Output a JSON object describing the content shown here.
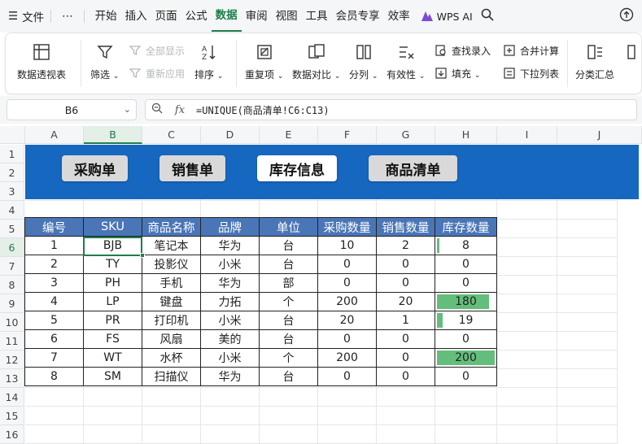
{
  "menubar": {
    "file": "文件",
    "more": "⋯",
    "tabs": [
      "开始",
      "插入",
      "页面",
      "公式",
      "数据",
      "审阅",
      "视图",
      "工具",
      "会员专享",
      "效率"
    ],
    "active_tab": "数据",
    "ai_label": "WPS AI"
  },
  "ribbon": {
    "pivot": "数据透视表",
    "filter": "筛选",
    "show_all": "全部显示",
    "reapply": "重新应用",
    "sort": "排序",
    "duplicates": "重复项",
    "compare": "数据对比",
    "split": "分列",
    "validity": "有效性",
    "find_entry": "查找录入",
    "fill": "填充",
    "consolidate": "合并计算",
    "dropdown_list": "下拉列表",
    "subtotal": "分类汇总"
  },
  "formula_bar": {
    "name_box": "B6",
    "fx": "fx",
    "formula": "=UNIQUE(商品清单!C6:C13)"
  },
  "columns": [
    "A",
    "B",
    "C",
    "D",
    "E",
    "F",
    "G",
    "H",
    "I",
    "J"
  ],
  "rows": [
    "1",
    "2",
    "3",
    "4",
    "5",
    "6",
    "7",
    "8",
    "9",
    "10",
    "11",
    "12",
    "13",
    "14",
    "15",
    "16"
  ],
  "selected_column": "B",
  "selected_row": "6",
  "nav_buttons": [
    {
      "label": "采购单",
      "active": false
    },
    {
      "label": "销售单",
      "active": false
    },
    {
      "label": "库存信息",
      "active": true
    },
    {
      "label": "商品清单",
      "active": false
    }
  ],
  "table": {
    "headers": [
      "编号",
      "SKU",
      "商品名称",
      "品牌",
      "单位",
      "采购数量",
      "销售数量",
      "库存数量"
    ],
    "rows": [
      [
        "1",
        "BJB",
        "笔记本",
        "华为",
        "台",
        "10",
        "2",
        "8"
      ],
      [
        "2",
        "TY",
        "投影仪",
        "小米",
        "台",
        "0",
        "0",
        "0"
      ],
      [
        "3",
        "PH",
        "手机",
        "华为",
        "部",
        "0",
        "0",
        "0"
      ],
      [
        "4",
        "LP",
        "键盘",
        "力拓",
        "个",
        "200",
        "20",
        "180"
      ],
      [
        "5",
        "PR",
        "打印机",
        "小米",
        "台",
        "20",
        "1",
        "19"
      ],
      [
        "6",
        "FS",
        "风扇",
        "美的",
        "台",
        "0",
        "0",
        "0"
      ],
      [
        "7",
        "WT",
        "水杯",
        "小米",
        "个",
        "200",
        "0",
        "200"
      ],
      [
        "8",
        "SM",
        "扫描仪",
        "华为",
        "台",
        "0",
        "0",
        "0"
      ]
    ],
    "databar_max": 200,
    "databar_color": "#63be7b",
    "header_color": "#4a76b7"
  },
  "banner_color": "#1667c0",
  "accent": "#1e7d4b"
}
